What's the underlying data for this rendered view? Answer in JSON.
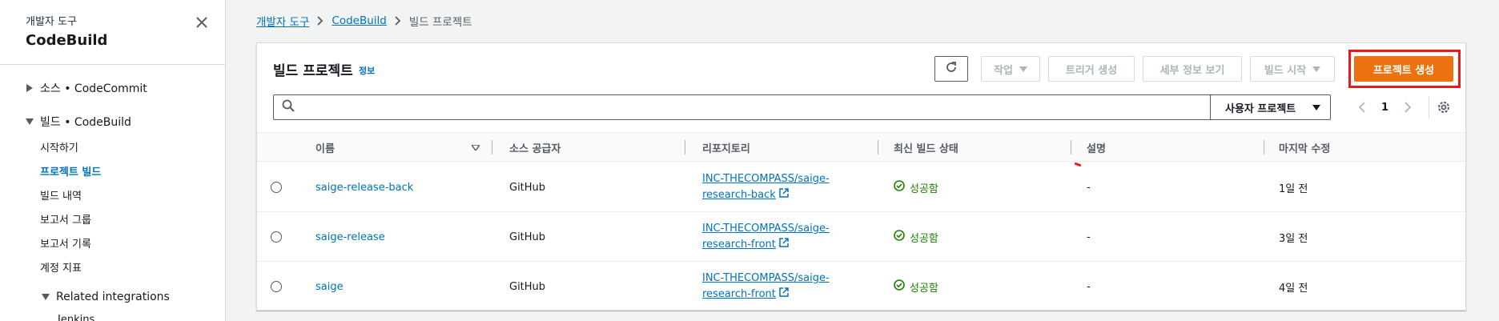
{
  "sidebar": {
    "subtitle": "개발자 도구",
    "title": "CodeBuild",
    "sections": [
      {
        "label": "소스 • CodeCommit",
        "expanded": false
      },
      {
        "label": "빌드 • CodeBuild",
        "expanded": true
      }
    ],
    "items": [
      {
        "label": "시작하기",
        "active": false
      },
      {
        "label": "프로젝트 빌드",
        "active": true
      },
      {
        "label": "빌드 내역",
        "active": false
      },
      {
        "label": "보고서 그룹",
        "active": false
      },
      {
        "label": "보고서 기록",
        "active": false
      },
      {
        "label": "계정 지표",
        "active": false
      }
    ],
    "related": "Related integrations",
    "partial_item": "Jenkins"
  },
  "breadcrumb": {
    "items": [
      "개발자 도구",
      "CodeBuild"
    ],
    "current": "빌드 프로젝트"
  },
  "panel": {
    "title": "빌드 프로젝트",
    "info": "정보"
  },
  "toolbar": {
    "actions": "작업",
    "create_trigger": "트리거 생성",
    "view_details": "세부 정보 보기",
    "start_build": "빌드 시작",
    "create_project": "프로젝트 생성"
  },
  "search": {
    "value": "",
    "placeholder": ""
  },
  "filter": {
    "selected": "사용자 프로젝트"
  },
  "pagination": {
    "page": "1"
  },
  "table": {
    "headers": [
      "이름",
      "소스 공급자",
      "리포지토리",
      "최신 빌드 상태",
      "설명",
      "마지막 수정"
    ],
    "rows": [
      {
        "name": "saige-release-back",
        "provider": "GitHub",
        "repo_line1": "INC-THECOMPASS/saige-",
        "repo_line2": "research-back",
        "status": "성공함",
        "description": "-",
        "modified": "1일 전"
      },
      {
        "name": "saige-release",
        "provider": "GitHub",
        "repo_line1": "INC-THECOMPASS/saige-",
        "repo_line2": "research-front",
        "status": "성공함",
        "description": "-",
        "modified": "3일 전"
      },
      {
        "name": "saige",
        "provider": "GitHub",
        "repo_line1": "INC-THECOMPASS/saige-",
        "repo_line2": "research-front",
        "status": "성공함",
        "description": "-",
        "modified": "4일 전"
      }
    ]
  },
  "colors": {
    "accent": "#0073bb",
    "primary": "#ec7211",
    "success": "#1d8102",
    "highlight": "#e31b1b"
  }
}
